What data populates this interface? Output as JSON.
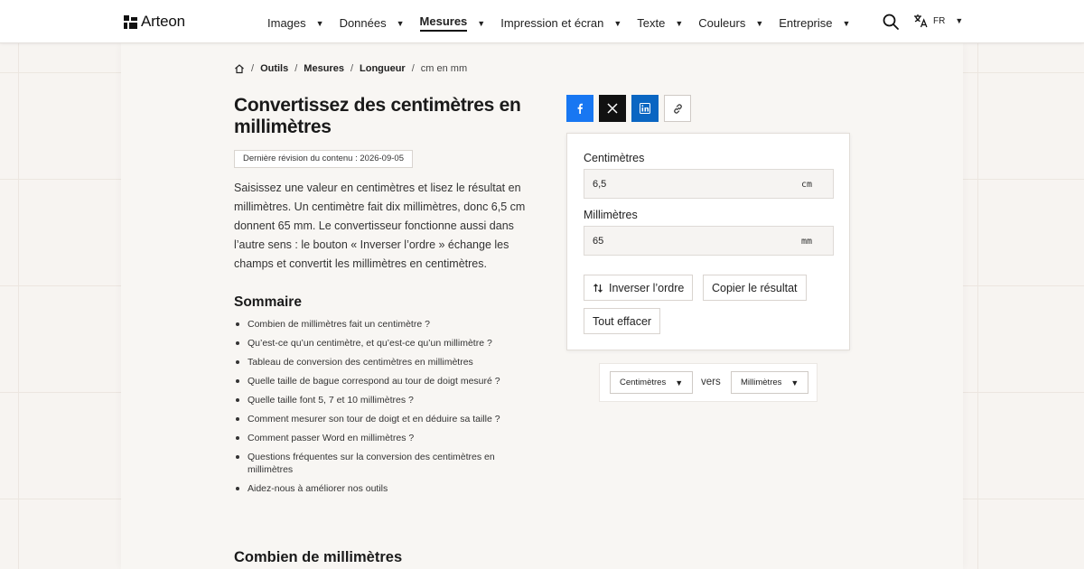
{
  "brand": {
    "name": "Arteon"
  },
  "nav": {
    "items": [
      {
        "label": "Images"
      },
      {
        "label": "Données"
      },
      {
        "label": "Mesures",
        "active": true
      },
      {
        "label": "Impression et écran"
      },
      {
        "label": "Texte"
      },
      {
        "label": "Couleurs"
      },
      {
        "label": "Entreprise"
      }
    ],
    "search_icon": "search-icon",
    "language": "FR"
  },
  "breadcrumb": {
    "home_icon": "home-icon",
    "items": [
      "Outils",
      "Mesures",
      "Longueur"
    ],
    "current": "cm en mm"
  },
  "article": {
    "title": "Convertissez des centimètres en millimètres",
    "revision": "Dernière révision du contenu : 2026-09-05",
    "intro": "Saisissez une valeur en centimètres et lisez le résultat en millimètres. Un centimètre fait dix millimètres, donc 6,5 cm donnent 65 mm. Le convertisseur fonctionne aussi dans l’autre sens : le bouton « Inverser l’ordre » échange les champs et convertit les millimètres en centimètres.",
    "toc_title": "Sommaire",
    "toc": [
      "Combien de millimètres fait un centimètre ?",
      "Qu’est-ce qu’un centimètre, et qu’est-ce qu’un millimètre ?",
      "Tableau de conversion des centimètres en millimètres",
      "Quelle taille de bague correspond au tour de doigt mesuré ?",
      "Quelle taille font 5, 7 et 10 millimètres ?",
      "Comment mesurer son tour de doigt et en déduire sa taille ?",
      "Comment passer Word en millimètres ?",
      "Questions fréquentes sur la conversion des centimètres en millimètres",
      "Aidez-nous à améliorer nos outils"
    ],
    "next_section": "Combien de millimètres"
  },
  "share": {
    "facebook_icon": "facebook-icon",
    "x_icon": "x-icon",
    "linkedin_icon": "linkedin-icon",
    "link_icon": "link-icon"
  },
  "converter": {
    "from_label": "Centimètres",
    "from_value": "6,5",
    "from_unit": "cm",
    "to_label": "Millimètres",
    "to_value": "65",
    "to_unit": "mm",
    "swap_label": "Inverser l’ordre",
    "copy_label": "Copier le résultat",
    "clear_label": "Tout effacer"
  },
  "unit_selector": {
    "from": "Centimètres",
    "connector": "vers",
    "to": "Millimètres"
  }
}
